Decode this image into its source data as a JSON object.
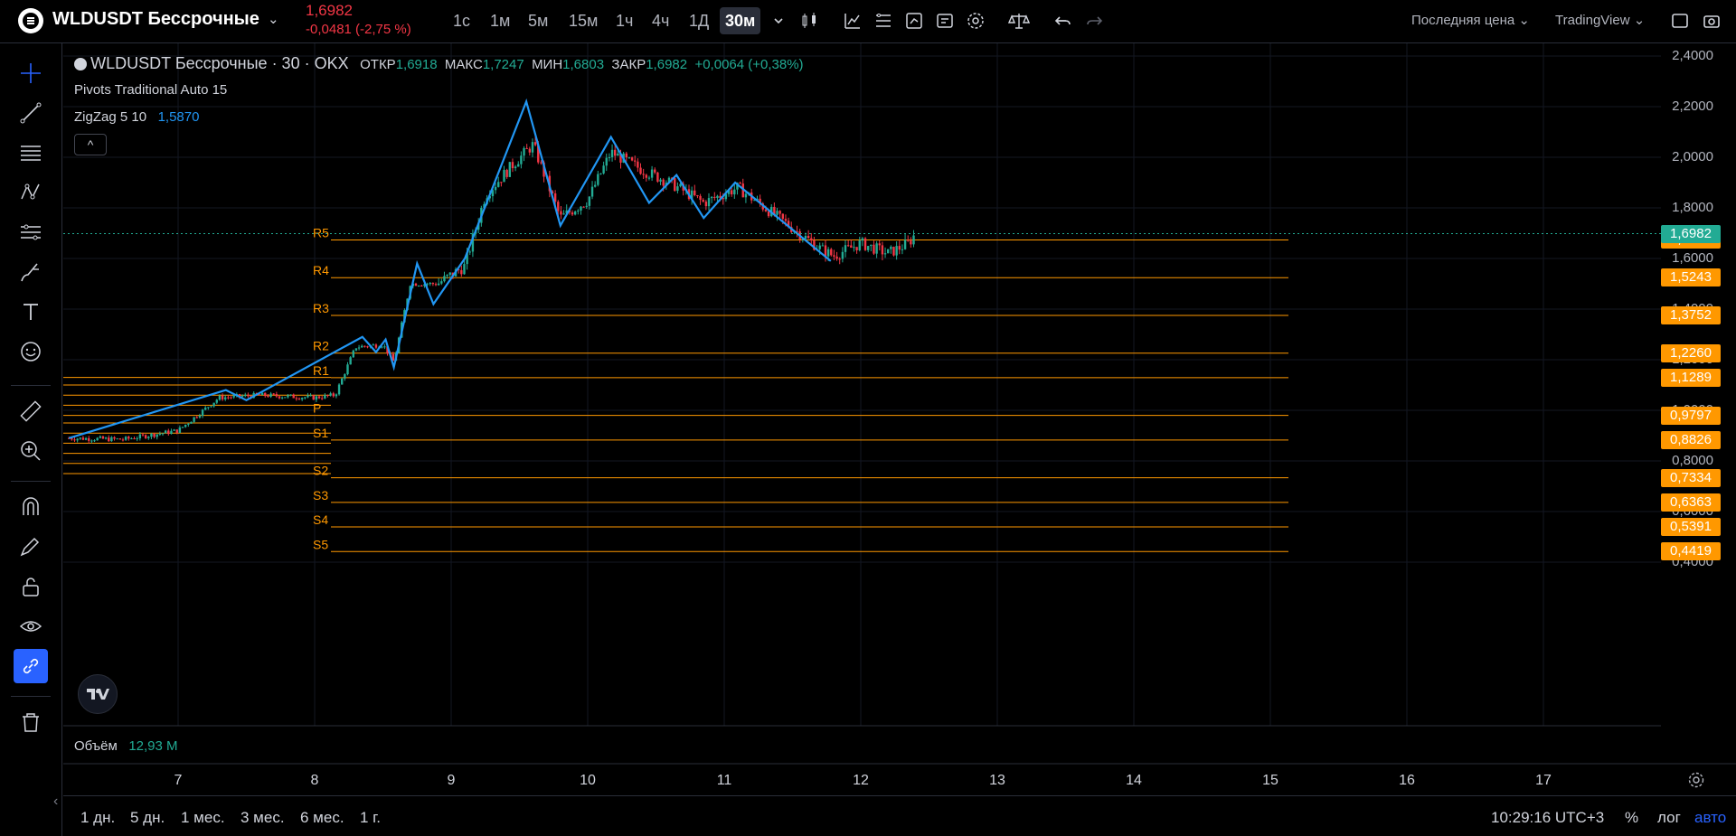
{
  "header": {
    "symbol": "WLDUSDT Бессрочные",
    "last_price": "1,6982",
    "change": "-0,0481 (-2,75 %)",
    "timeframes": [
      {
        "label": "1с",
        "active": false
      },
      {
        "label": "1м",
        "active": false
      },
      {
        "label": "5м",
        "active": false
      },
      {
        "label": "15м",
        "active": false
      },
      {
        "label": "1ч",
        "active": false
      },
      {
        "label": "4ч",
        "active": false
      },
      {
        "label": "1Д",
        "active": false
      },
      {
        "label": "30м",
        "active": true
      }
    ],
    "price_source": "Последняя цена",
    "chart_style": "TradingView"
  },
  "legend": {
    "symbol_line": "WLDUSDT Бессрочные · 30 · OKX",
    "open_label": "ОТКР",
    "open": "1,6918",
    "high_label": "МАКС",
    "high": "1,7247",
    "low_label": "МИН",
    "low": "1,6803",
    "close_label": "ЗАКР",
    "close": "1,6982",
    "change": "+0,0064 (+0,38%)"
  },
  "indicators": {
    "pivots": "Pivots Traditional Auto 15",
    "zigzag": "ZigZag 5 10",
    "zigzag_value": "1,5870",
    "collapse": "^"
  },
  "volume": {
    "label": "Объём",
    "value": "12,93 M"
  },
  "price_axis": {
    "labels": [
      "2,4000",
      "2,2000",
      "2,0000",
      "1,8000",
      "1,6000",
      "1,4000",
      "1,2000",
      "1,0000",
      "0,8000",
      "0,6000",
      "0,4000"
    ]
  },
  "pivots": [
    {
      "name": "R5",
      "value": "1,6734",
      "price": 1.6734
    },
    {
      "name": "R4",
      "value": "1,5243",
      "price": 1.5243
    },
    {
      "name": "R3",
      "value": "1,3752",
      "price": 1.3752
    },
    {
      "name": "R2",
      "value": "1,2260",
      "price": 1.226
    },
    {
      "name": "R1",
      "value": "1,1289",
      "price": 1.1289
    },
    {
      "name": "P",
      "value": "0,9797",
      "price": 0.9797
    },
    {
      "name": "S1",
      "value": "0,8826",
      "price": 0.8826
    },
    {
      "name": "S2",
      "value": "0,7334",
      "price": 0.7334
    },
    {
      "name": "S3",
      "value": "0,6363",
      "price": 0.6363
    },
    {
      "name": "S4",
      "value": "0,5391",
      "price": 0.5391
    },
    {
      "name": "S5",
      "value": "0,4419",
      "price": 0.4419
    }
  ],
  "current_price_tag": "1,6982",
  "time_axis": {
    "labels": [
      "7",
      "8",
      "9",
      "10",
      "11",
      "12",
      "13",
      "14",
      "15",
      "16",
      "17"
    ]
  },
  "bottom": {
    "ranges": [
      "1 дн.",
      "5 дн.",
      "1 мес.",
      "3 мес.",
      "6 мес.",
      "1 г."
    ],
    "time": "10:29:16 UTC+3",
    "percent": "%",
    "log": "лог",
    "auto": "авто"
  },
  "colors": {
    "up": "#22ab94",
    "down": "#f23645",
    "pivot": "#ff9800",
    "zigzag": "#2196f3",
    "price_tag": "#22ab94"
  },
  "chart_data": {
    "type": "candlestick",
    "title": "WLDUSDT Бессрочные · 30 · OKX",
    "x_unit": "day",
    "ylim": [
      0.35,
      2.45
    ],
    "zigzag": [
      {
        "x": 6.2,
        "y": 0.89
      },
      {
        "x": 7.35,
        "y": 1.08
      },
      {
        "x": 7.5,
        "y": 1.04
      },
      {
        "x": 8.35,
        "y": 1.29
      },
      {
        "x": 8.45,
        "y": 1.23
      },
      {
        "x": 8.52,
        "y": 1.28
      },
      {
        "x": 8.58,
        "y": 1.17
      },
      {
        "x": 8.75,
        "y": 1.58
      },
      {
        "x": 8.87,
        "y": 1.42
      },
      {
        "x": 9.1,
        "y": 1.6
      },
      {
        "x": 9.55,
        "y": 2.22
      },
      {
        "x": 9.8,
        "y": 1.73
      },
      {
        "x": 10.17,
        "y": 2.08
      },
      {
        "x": 10.45,
        "y": 1.82
      },
      {
        "x": 10.65,
        "y": 1.93
      },
      {
        "x": 10.85,
        "y": 1.76
      },
      {
        "x": 11.08,
        "y": 1.9
      },
      {
        "x": 11.78,
        "y": 1.59
      }
    ],
    "close_series": [
      {
        "x": 6.2,
        "y": 0.89
      },
      {
        "x": 6.6,
        "y": 0.885
      },
      {
        "x": 7.0,
        "y": 0.92
      },
      {
        "x": 7.3,
        "y": 1.05
      },
      {
        "x": 7.6,
        "y": 1.06
      },
      {
        "x": 8.0,
        "y": 1.05
      },
      {
        "x": 8.15,
        "y": 1.06
      },
      {
        "x": 8.3,
        "y": 1.25
      },
      {
        "x": 8.5,
        "y": 1.26
      },
      {
        "x": 8.58,
        "y": 1.19
      },
      {
        "x": 8.7,
        "y": 1.5
      },
      {
        "x": 8.9,
        "y": 1.5
      },
      {
        "x": 9.1,
        "y": 1.57
      },
      {
        "x": 9.25,
        "y": 1.85
      },
      {
        "x": 9.45,
        "y": 1.97
      },
      {
        "x": 9.6,
        "y": 2.05
      },
      {
        "x": 9.8,
        "y": 1.76
      },
      {
        "x": 10.0,
        "y": 1.83
      },
      {
        "x": 10.17,
        "y": 2.02
      },
      {
        "x": 10.4,
        "y": 1.95
      },
      {
        "x": 10.6,
        "y": 1.9
      },
      {
        "x": 10.85,
        "y": 1.82
      },
      {
        "x": 11.1,
        "y": 1.88
      },
      {
        "x": 11.4,
        "y": 1.76
      },
      {
        "x": 11.7,
        "y": 1.64
      },
      {
        "x": 11.8,
        "y": 1.61
      },
      {
        "x": 12.0,
        "y": 1.66
      },
      {
        "x": 12.2,
        "y": 1.62
      },
      {
        "x": 12.35,
        "y": 1.66
      },
      {
        "x": 12.4,
        "y": 1.6982
      }
    ]
  }
}
